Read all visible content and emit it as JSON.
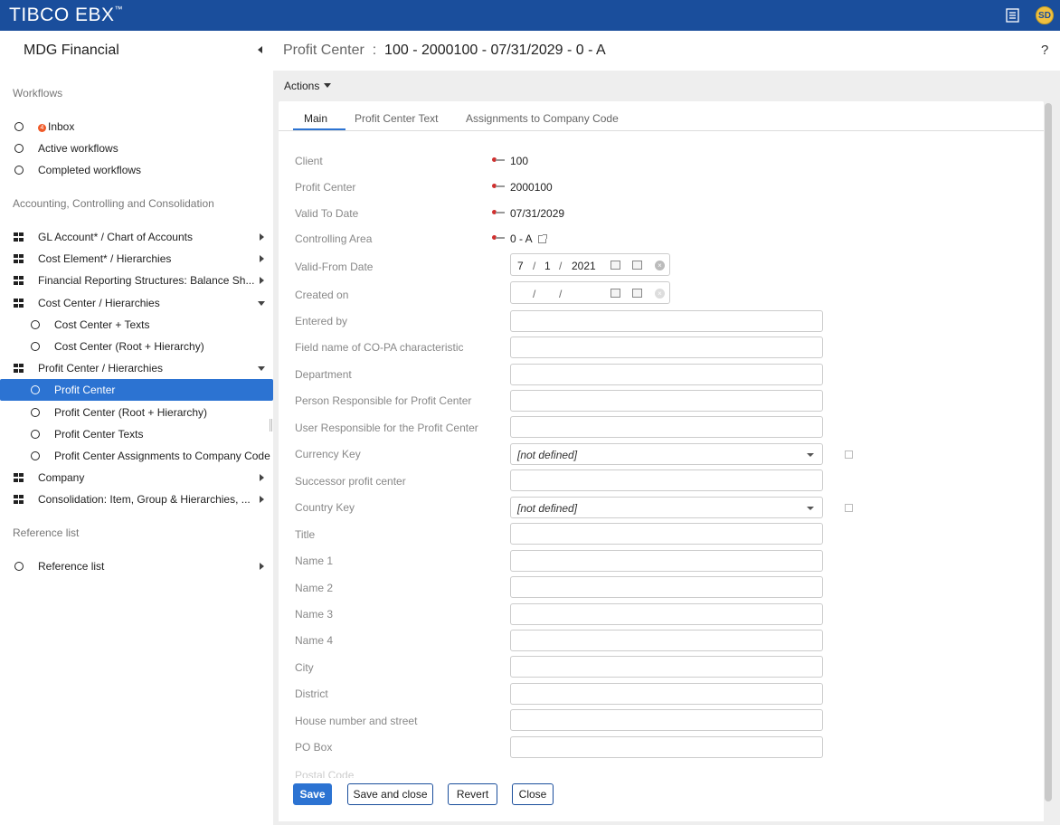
{
  "app": {
    "logo": "TIBC",
    "logo_o": "O",
    "logo_rest": " EBX",
    "tm": "™",
    "user_initials": "SD"
  },
  "sidebar": {
    "title": "MDG Financial",
    "sections": {
      "workflows": "Workflows",
      "accounting": "Accounting, Controlling and Consolidation",
      "reference": "Reference list"
    },
    "workflows": [
      {
        "label": "Inbox",
        "badge": "4"
      },
      {
        "label": "Active workflows"
      },
      {
        "label": "Completed workflows"
      }
    ],
    "accounting": [
      {
        "label": "GL Account* / Chart of Accounts"
      },
      {
        "label": "Cost Element* / Hierarchies"
      },
      {
        "label": "Financial Reporting Structures: Balance Sh..."
      },
      {
        "label": "Cost Center / Hierarchies"
      },
      {
        "label": "Cost Center + Texts"
      },
      {
        "label": "Cost Center (Root + Hierarchy)"
      },
      {
        "label": "Profit Center / Hierarchies"
      },
      {
        "label": "Profit Center"
      },
      {
        "label": "Profit Center (Root + Hierarchy)"
      },
      {
        "label": "Profit Center Texts"
      },
      {
        "label": "Profit Center Assignments to Company Code"
      },
      {
        "label": "Company"
      },
      {
        "label": "Consolidation: Item, Group & Hierarchies, ..."
      }
    ],
    "reference": [
      {
        "label": "Reference list"
      }
    ]
  },
  "header": {
    "entity": "Profit Center",
    "sep": ":",
    "record": "100 - 2000100 - 07/31/2029 - 0 - A",
    "help": "?"
  },
  "actions_label": "Actions",
  "tabs": [
    "Main",
    "Profit Center Text",
    "Assignments to Company Code"
  ],
  "fields": {
    "client": {
      "label": "Client",
      "value": "100"
    },
    "profit_center": {
      "label": "Profit Center",
      "value": "2000100"
    },
    "valid_to": {
      "label": "Valid To Date",
      "value": "07/31/2029"
    },
    "controlling_area": {
      "label": "Controlling Area",
      "value": "0 - A"
    },
    "valid_from": {
      "label": "Valid-From Date",
      "month": "7",
      "day": "1",
      "year": "2021",
      "sep": "/"
    },
    "created_on": {
      "label": "Created on",
      "sep": "/"
    },
    "entered_by": {
      "label": "Entered by"
    },
    "copa": {
      "label": "Field name of CO-PA characteristic"
    },
    "department": {
      "label": "Department"
    },
    "person_resp": {
      "label": "Person Responsible for Profit Center"
    },
    "user_resp": {
      "label": "User Responsible for the Profit Center"
    },
    "currency": {
      "label": "Currency Key",
      "value": "[not defined]"
    },
    "successor": {
      "label": "Successor profit center"
    },
    "country": {
      "label": "Country Key",
      "value": "[not defined]"
    },
    "title": {
      "label": "Title"
    },
    "name1": {
      "label": "Name 1"
    },
    "name2": {
      "label": "Name 2"
    },
    "name3": {
      "label": "Name 3"
    },
    "name4": {
      "label": "Name 4"
    },
    "city": {
      "label": "City"
    },
    "district": {
      "label": "District"
    },
    "house": {
      "label": "House number and street"
    },
    "pobox": {
      "label": "PO Box"
    },
    "postal": {
      "label": "Postal Code"
    }
  },
  "buttons": {
    "save": "Save",
    "save_close": "Save and close",
    "revert": "Revert",
    "close": "Close"
  },
  "colors": {
    "topbar": "#1a4e9c",
    "accent": "#2c73d2",
    "badge": "#f05a28",
    "key": "#d0302f"
  }
}
